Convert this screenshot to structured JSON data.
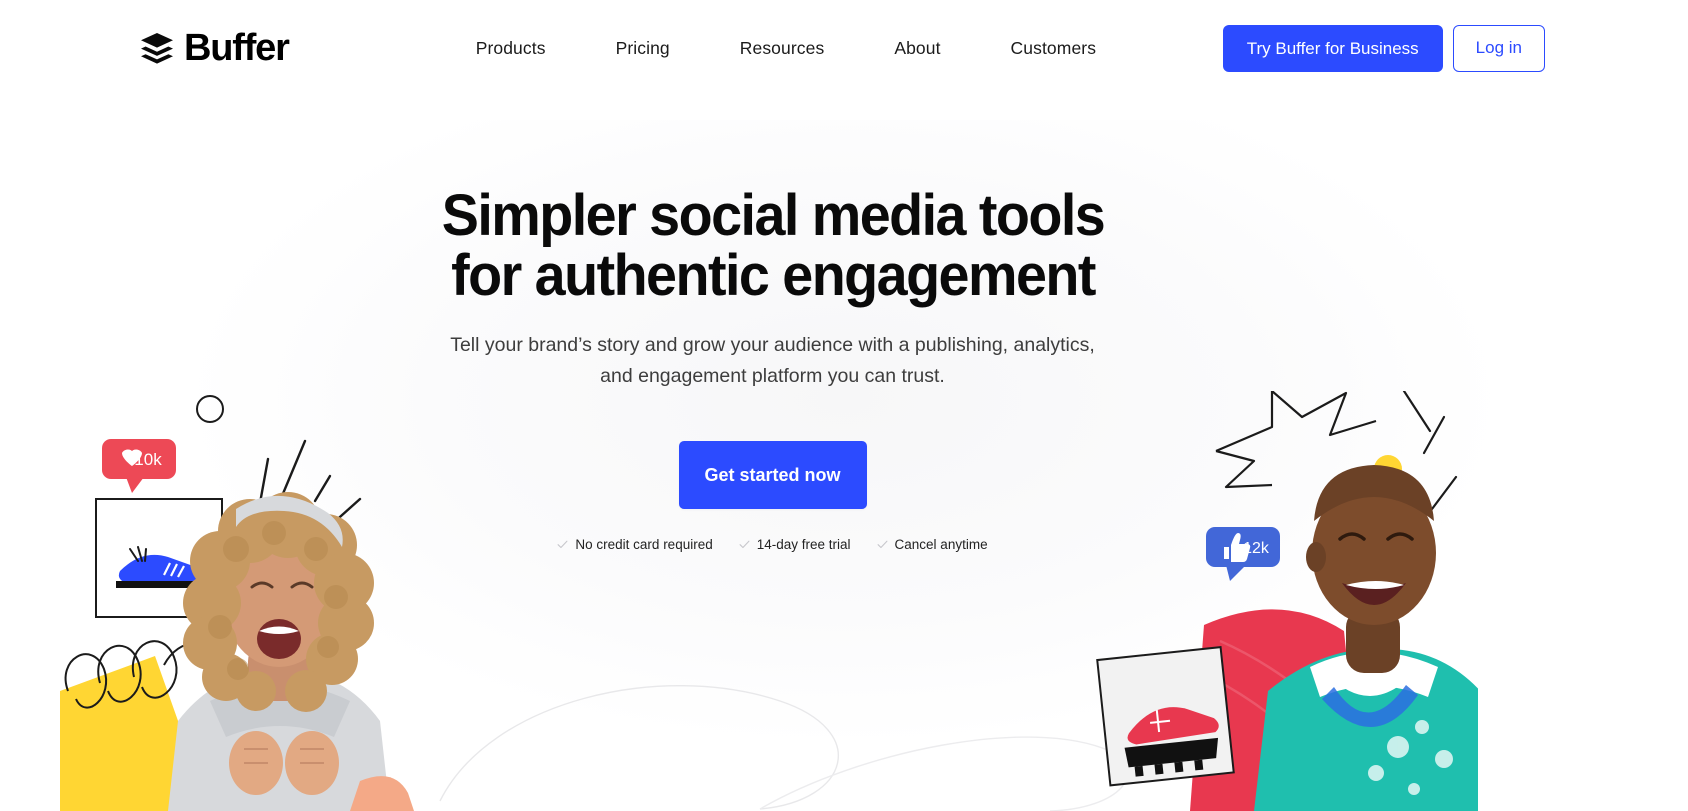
{
  "brand": {
    "name": "Buffer",
    "logo_icon": "buffer-stacked-layers-icon",
    "accent_blue": "#2c4bff",
    "text_dark": "#0a0a0a"
  },
  "nav": {
    "items": [
      {
        "label": "Products"
      },
      {
        "label": "Pricing"
      },
      {
        "label": "Resources"
      },
      {
        "label": "About"
      },
      {
        "label": "Customers"
      }
    ],
    "cta_business": "Try Buffer for Business",
    "login": "Log in"
  },
  "hero": {
    "headline_line1": "Simpler social media tools",
    "headline_line2": "for authentic engagement",
    "subhead_line1": "Tell your brand’s story and grow your audience with a",
    "subhead_line2": "publishing, analytics, and engagement platform you can trust.",
    "cta_label": "Get started now",
    "perks": [
      {
        "icon": "check-icon",
        "label": "No credit card required"
      },
      {
        "icon": "check-icon",
        "label": "14-day free trial"
      },
      {
        "icon": "check-icon",
        "label": "Cancel anytime"
      }
    ]
  },
  "illustrations": {
    "left": {
      "name": "woman-celebrating-photo",
      "like_badge": {
        "icon": "heart-icon",
        "count": "10k",
        "color": "#ed4956"
      },
      "photo_card": {
        "subject": "blue-sneaker-photo"
      },
      "shapes": [
        "yellow-blob",
        "circle-outline-doodle",
        "spring-coil-doodle",
        "burst-line-doodle",
        "dot-doodle"
      ]
    },
    "right": {
      "name": "man-smiling-photo",
      "like_badge": {
        "icon": "thumbs-up-icon",
        "count": "12k",
        "color": "#4267d8"
      },
      "photo_card": {
        "subject": "red-cleat-photo"
      },
      "shapes": [
        "red-blob",
        "yellow-dot",
        "star-outline-doodle",
        "zigzag-line-doodle",
        "dot-doodle"
      ]
    },
    "center": {
      "name": "looping-swirl-doodle"
    }
  }
}
